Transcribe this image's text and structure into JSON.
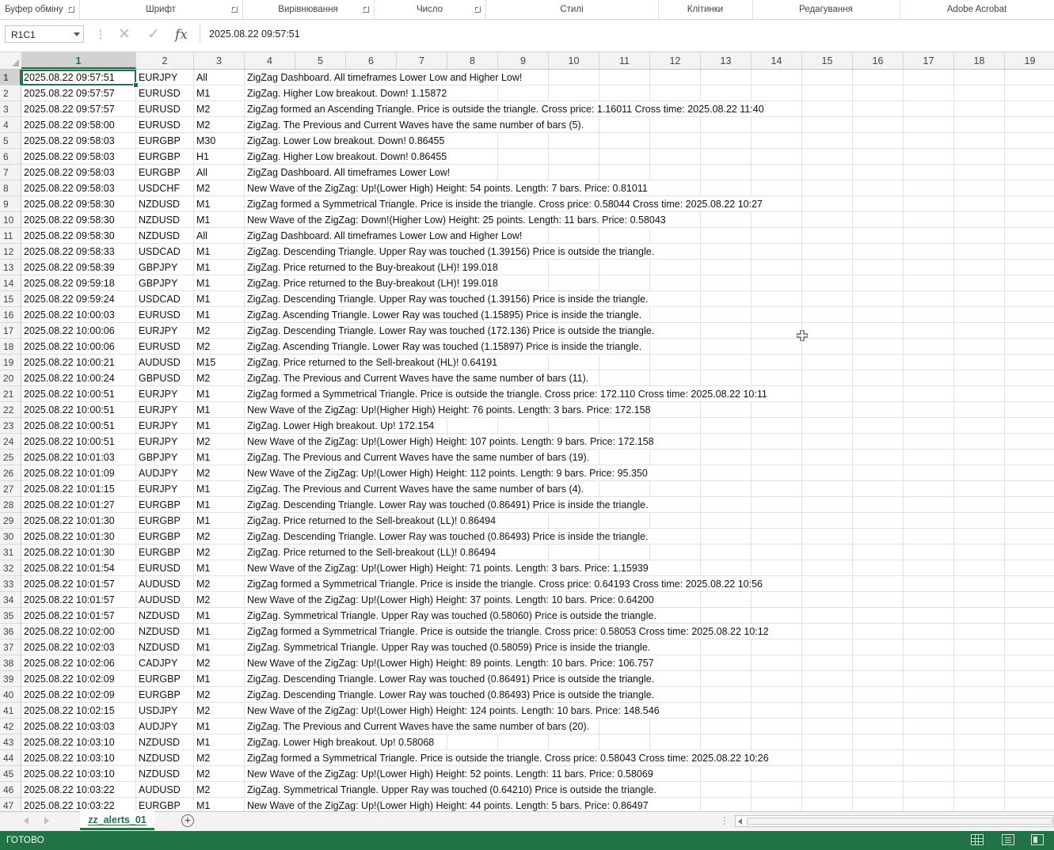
{
  "ribbon": {
    "groups": [
      {
        "label": "Буфер обміну",
        "launcher": true
      },
      {
        "label": "Шрифт",
        "launcher": true
      },
      {
        "label": "Вирівнювання",
        "launcher": true
      },
      {
        "label": "Число",
        "launcher": true
      },
      {
        "label": "Стилі",
        "launcher": false
      },
      {
        "label": "Клітинки",
        "launcher": false
      },
      {
        "label": "Редагування",
        "launcher": false
      },
      {
        "label": "Adobe Acrobat",
        "launcher": false
      }
    ]
  },
  "formula_bar": {
    "name_box": "R1C1",
    "separator": "⋮",
    "cancel_icon": "✕",
    "enter_icon": "✓",
    "fx_label": "fx",
    "content": "2025.08.22 09:57:51"
  },
  "columns": [
    "1",
    "2",
    "3",
    "4",
    "5",
    "6",
    "7",
    "8",
    "9",
    "10",
    "11",
    "12",
    "13",
    "14",
    "15",
    "16",
    "17",
    "18",
    "19"
  ],
  "selected_column": "1",
  "selected_row": "1",
  "rows": [
    {
      "n": "1",
      "date": "2025.08.22 09:57:51",
      "symbol": "EURJPY",
      "tf": "All",
      "msg": "ZigZag Dashboard. All timeframes Lower Low and Higher Low!"
    },
    {
      "n": "2",
      "date": "2025.08.22 09:57:57",
      "symbol": "EURUSD",
      "tf": "M1",
      "msg": "ZigZag. Higher Low breakout. Down! 1.15872"
    },
    {
      "n": "3",
      "date": "2025.08.22 09:57:57",
      "symbol": "EURUSD",
      "tf": "M2",
      "msg": "ZigZag formed an Ascending Triangle. Price is outside the triangle. Cross price: 1.16011 Cross time: 2025.08.22 11:40"
    },
    {
      "n": "4",
      "date": "2025.08.22 09:58:00",
      "symbol": "EURUSD",
      "tf": "M2",
      "msg": "ZigZag. The Previous and Current Waves have the same number of bars (5)."
    },
    {
      "n": "5",
      "date": "2025.08.22 09:58:03",
      "symbol": "EURGBP",
      "tf": "M30",
      "msg": "ZigZag. Lower Low breakout. Down! 0.86455"
    },
    {
      "n": "6",
      "date": "2025.08.22 09:58:03",
      "symbol": "EURGBP",
      "tf": "H1",
      "msg": "ZigZag. Higher Low breakout. Down! 0.86455"
    },
    {
      "n": "7",
      "date": "2025.08.22 09:58:03",
      "symbol": "EURGBP",
      "tf": "All",
      "msg": "ZigZag Dashboard. All timeframes Lower Low!"
    },
    {
      "n": "8",
      "date": "2025.08.22 09:58:03",
      "symbol": "USDCHF",
      "tf": "M2",
      "msg": "New Wave of the ZigZag: Up!(Lower High) Height: 54 points. Length: 7 bars. Price: 0.81011"
    },
    {
      "n": "9",
      "date": "2025.08.22 09:58:30",
      "symbol": "NZDUSD",
      "tf": "M1",
      "msg": "ZigZag formed a Symmetrical Triangle. Price is inside the triangle. Cross price: 0.58044 Cross time: 2025.08.22 10:27"
    },
    {
      "n": "10",
      "date": "2025.08.22 09:58:30",
      "symbol": "NZDUSD",
      "tf": "M1",
      "msg": "New Wave of the ZigZag: Down!(Higher Low) Height: 25 points. Length: 11 bars. Price: 0.58043"
    },
    {
      "n": "11",
      "date": "2025.08.22 09:58:30",
      "symbol": "NZDUSD",
      "tf": "All",
      "msg": "ZigZag Dashboard. All timeframes Lower Low and Higher Low!"
    },
    {
      "n": "12",
      "date": "2025.08.22 09:58:33",
      "symbol": "USDCAD",
      "tf": "M1",
      "msg": "ZigZag. Descending Triangle. Upper Ray was touched (1.39156) Price is outside the triangle."
    },
    {
      "n": "13",
      "date": "2025.08.22 09:58:39",
      "symbol": "GBPJPY",
      "tf": "M1",
      "msg": "ZigZag. Price returned to the Buy-breakout (LH)! 199.018"
    },
    {
      "n": "14",
      "date": "2025.08.22 09:59:18",
      "symbol": "GBPJPY",
      "tf": "M1",
      "msg": "ZigZag. Price returned to the Buy-breakout (LH)! 199.018"
    },
    {
      "n": "15",
      "date": "2025.08.22 09:59:24",
      "symbol": "USDCAD",
      "tf": "M1",
      "msg": "ZigZag. Descending Triangle. Upper Ray was touched (1.39156) Price is inside the triangle."
    },
    {
      "n": "16",
      "date": "2025.08.22 10:00:03",
      "symbol": "EURUSD",
      "tf": "M1",
      "msg": "ZigZag. Ascending Triangle. Lower Ray was touched (1.15895) Price is inside the triangle."
    },
    {
      "n": "17",
      "date": "2025.08.22 10:00:06",
      "symbol": "EURJPY",
      "tf": "M2",
      "msg": "ZigZag. Descending Triangle. Lower Ray was touched (172.136) Price is outside the triangle."
    },
    {
      "n": "18",
      "date": "2025.08.22 10:00:06",
      "symbol": "EURUSD",
      "tf": "M2",
      "msg": "ZigZag. Ascending Triangle. Lower Ray was touched (1.15897) Price is inside the triangle."
    },
    {
      "n": "19",
      "date": "2025.08.22 10:00:21",
      "symbol": "AUDUSD",
      "tf": "M15",
      "msg": "ZigZag. Price returned to the Sell-breakout (HL)! 0.64191"
    },
    {
      "n": "20",
      "date": "2025.08.22 10:00:24",
      "symbol": "GBPUSD",
      "tf": "M2",
      "msg": "ZigZag. The Previous and Current Waves have the same number of bars (11)."
    },
    {
      "n": "21",
      "date": "2025.08.22 10:00:51",
      "symbol": "EURJPY",
      "tf": "M1",
      "msg": "ZigZag formed a Symmetrical Triangle. Price is outside the triangle. Cross price: 172.110 Cross time: 2025.08.22 10:11"
    },
    {
      "n": "22",
      "date": "2025.08.22 10:00:51",
      "symbol": "EURJPY",
      "tf": "M1",
      "msg": "New Wave of the ZigZag: Up!(Higher High) Height: 76 points. Length: 3 bars. Price: 172.158"
    },
    {
      "n": "23",
      "date": "2025.08.22 10:00:51",
      "symbol": "EURJPY",
      "tf": "M1",
      "msg": "ZigZag. Lower High breakout. Up! 172.154"
    },
    {
      "n": "24",
      "date": "2025.08.22 10:00:51",
      "symbol": "EURJPY",
      "tf": "M2",
      "msg": "New Wave of the ZigZag: Up!(Lower High) Height: 107 points. Length: 9 bars. Price: 172.158"
    },
    {
      "n": "25",
      "date": "2025.08.22 10:01:03",
      "symbol": "GBPJPY",
      "tf": "M1",
      "msg": "ZigZag. The Previous and Current Waves have the same number of bars (19)."
    },
    {
      "n": "26",
      "date": "2025.08.22 10:01:09",
      "symbol": "AUDJPY",
      "tf": "M2",
      "msg": "New Wave of the ZigZag: Up!(Lower High) Height: 112 points. Length: 9 bars. Price: 95.350"
    },
    {
      "n": "27",
      "date": "2025.08.22 10:01:15",
      "symbol": "EURJPY",
      "tf": "M1",
      "msg": "ZigZag. The Previous and Current Waves have the same number of bars (4)."
    },
    {
      "n": "28",
      "date": "2025.08.22 10:01:27",
      "symbol": "EURGBP",
      "tf": "M1",
      "msg": "ZigZag. Descending Triangle. Lower Ray was touched (0.86491) Price is inside the triangle."
    },
    {
      "n": "29",
      "date": "2025.08.22 10:01:30",
      "symbol": "EURGBP",
      "tf": "M1",
      "msg": "ZigZag. Price returned to the Sell-breakout (LL)! 0.86494"
    },
    {
      "n": "30",
      "date": "2025.08.22 10:01:30",
      "symbol": "EURGBP",
      "tf": "M2",
      "msg": "ZigZag. Descending Triangle. Lower Ray was touched (0.86493) Price is inside the triangle."
    },
    {
      "n": "31",
      "date": "2025.08.22 10:01:30",
      "symbol": "EURGBP",
      "tf": "M2",
      "msg": "ZigZag. Price returned to the Sell-breakout (LL)! 0.86494"
    },
    {
      "n": "32",
      "date": "2025.08.22 10:01:54",
      "symbol": "EURUSD",
      "tf": "M1",
      "msg": "New Wave of the ZigZag: Up!(Lower High) Height: 71 points. Length: 3 bars. Price: 1.15939"
    },
    {
      "n": "33",
      "date": "2025.08.22 10:01:57",
      "symbol": "AUDUSD",
      "tf": "M2",
      "msg": "ZigZag formed a Symmetrical Triangle. Price is inside the triangle. Cross price: 0.64193 Cross time: 2025.08.22 10:56"
    },
    {
      "n": "34",
      "date": "2025.08.22 10:01:57",
      "symbol": "AUDUSD",
      "tf": "M2",
      "msg": "New Wave of the ZigZag: Up!(Lower High) Height: 37 points. Length: 10 bars. Price: 0.64200"
    },
    {
      "n": "35",
      "date": "2025.08.22 10:01:57",
      "symbol": "NZDUSD",
      "tf": "M1",
      "msg": "ZigZag. Symmetrical Triangle. Upper Ray was touched (0.58060) Price is outside the triangle."
    },
    {
      "n": "36",
      "date": "2025.08.22 10:02:00",
      "symbol": "NZDUSD",
      "tf": "M1",
      "msg": "ZigZag formed a Symmetrical Triangle. Price is outside the triangle. Cross price: 0.58053 Cross time: 2025.08.22 10:12"
    },
    {
      "n": "37",
      "date": "2025.08.22 10:02:03",
      "symbol": "NZDUSD",
      "tf": "M1",
      "msg": "ZigZag. Symmetrical Triangle. Upper Ray was touched (0.58059) Price is inside the triangle."
    },
    {
      "n": "38",
      "date": "2025.08.22 10:02:06",
      "symbol": "CADJPY",
      "tf": "M2",
      "msg": "New Wave of the ZigZag: Up!(Lower High) Height: 89 points. Length: 10 bars. Price: 106.757"
    },
    {
      "n": "39",
      "date": "2025.08.22 10:02:09",
      "symbol": "EURGBP",
      "tf": "M1",
      "msg": "ZigZag. Descending Triangle. Lower Ray was touched (0.86491) Price is outside the triangle."
    },
    {
      "n": "40",
      "date": "2025.08.22 10:02:09",
      "symbol": "EURGBP",
      "tf": "M2",
      "msg": "ZigZag. Descending Triangle. Lower Ray was touched (0.86493) Price is outside the triangle."
    },
    {
      "n": "41",
      "date": "2025.08.22 10:02:15",
      "symbol": "USDJPY",
      "tf": "M2",
      "msg": "New Wave of the ZigZag: Up!(Lower High) Height: 124 points. Length: 10 bars. Price: 148.546"
    },
    {
      "n": "42",
      "date": "2025.08.22 10:03:03",
      "symbol": "AUDJPY",
      "tf": "M1",
      "msg": "ZigZag. The Previous and Current Waves have the same number of bars (20)."
    },
    {
      "n": "43",
      "date": "2025.08.22 10:03:10",
      "symbol": "NZDUSD",
      "tf": "M1",
      "msg": "ZigZag. Lower High breakout. Up! 0.58068"
    },
    {
      "n": "44",
      "date": "2025.08.22 10:03:10",
      "symbol": "NZDUSD",
      "tf": "M2",
      "msg": "ZigZag formed a Symmetrical Triangle. Price is outside the triangle. Cross price: 0.58043 Cross time: 2025.08.22 10:26"
    },
    {
      "n": "45",
      "date": "2025.08.22 10:03:10",
      "symbol": "NZDUSD",
      "tf": "M2",
      "msg": "New Wave of the ZigZag: Up!(Lower High) Height: 52 points. Length: 11 bars. Price: 0.58069"
    },
    {
      "n": "46",
      "date": "2025.08.22 10:03:22",
      "symbol": "AUDUSD",
      "tf": "M2",
      "msg": "ZigZag. Symmetrical Triangle. Upper Ray was touched (0.64210) Price is outside the triangle."
    },
    {
      "n": "47",
      "date": "2025.08.22 10:03:22",
      "symbol": "EURGBP",
      "tf": "M1",
      "msg": "New Wave of the ZigZag: Up!(Lower High) Height: 44 points. Length: 5 bars. Price: 0.86497"
    }
  ],
  "sheet_tabs": [
    {
      "label": "zz_alerts_01",
      "active": true
    }
  ],
  "add_sheet_icon": "+",
  "status_bar": {
    "ready": "ГОТОВО"
  },
  "colors": {
    "accent": "#217346",
    "grid": "#e2e2e2",
    "header_bg": "#f3f3f3"
  }
}
